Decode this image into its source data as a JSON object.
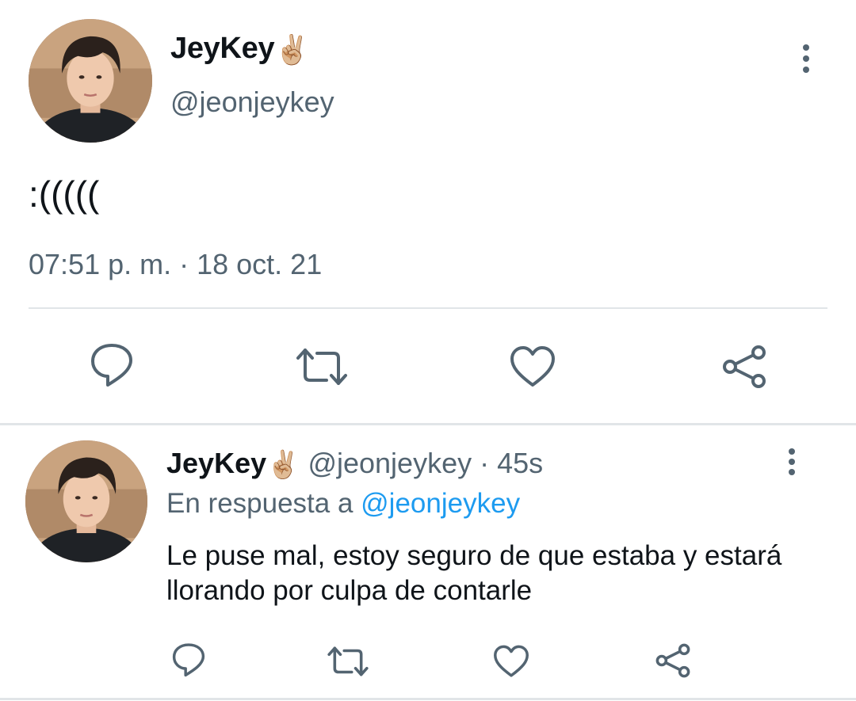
{
  "main_tweet": {
    "display_name": "JeyKey",
    "name_emoji": "✌🏼",
    "handle": "@jeonjeykey",
    "text": ":(((((",
    "timestamp": "07:51 p. m. · 18 oct. 21",
    "more_icon": "kebab-vertical-icon",
    "actions": [
      "reply-icon",
      "retweet-icon",
      "like-icon",
      "share-icon"
    ]
  },
  "reply_tweet": {
    "display_name": "JeyKey",
    "name_emoji": "✌🏼",
    "handle": "@jeonjeykey",
    "separator": " · ",
    "time_ago": "45s",
    "replying_to_label": "En respuesta a ",
    "replying_to_handle": "@jeonjeykey",
    "text": "Le puse mal, estoy seguro de que estaba y estará llorando por culpa de contarle",
    "more_icon": "kebab-vertical-icon",
    "actions": [
      "reply-icon",
      "retweet-icon",
      "like-icon",
      "share-icon"
    ]
  },
  "colors": {
    "text_primary": "#0f1419",
    "text_secondary": "#536471",
    "link": "#1d9bf0",
    "divider": "#e1e5e8"
  }
}
